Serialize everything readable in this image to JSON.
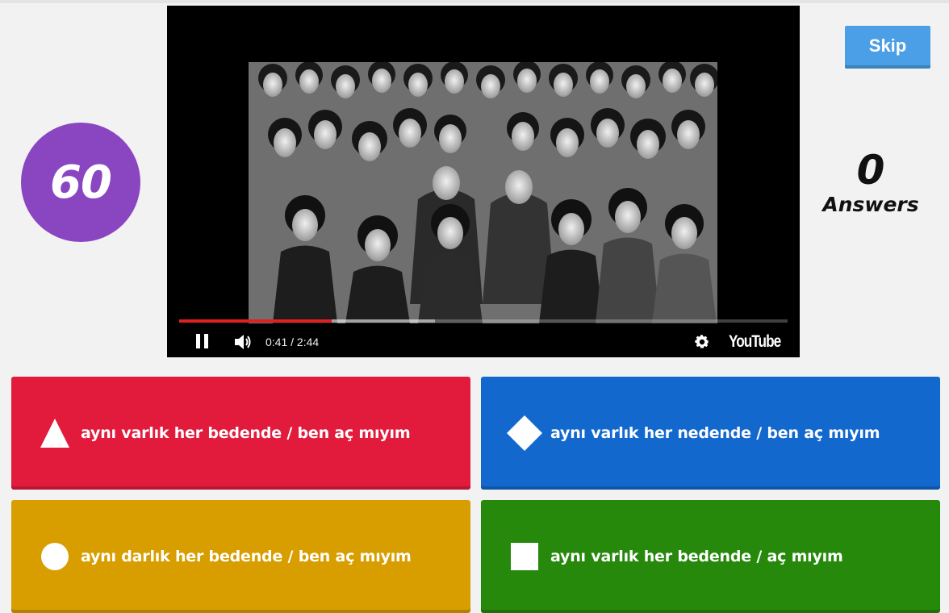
{
  "timer": {
    "value": "60"
  },
  "video": {
    "time_display": "0:41 / 2:44",
    "progress_fraction": 0.25,
    "buffer_fraction": 0.42,
    "brand": "YouTube",
    "progress_color": "#e01f1f"
  },
  "skip": {
    "label": "Skip"
  },
  "answers": {
    "count": "0",
    "label": "Answers"
  },
  "options": [
    {
      "shape": "triangle-icon",
      "color": "#e21b3c",
      "text": "aynı varlık her bedende / ben aç mıyım"
    },
    {
      "shape": "diamond-icon",
      "color": "#1368ce",
      "text": "aynı varlık her nedende / ben aç mıyım"
    },
    {
      "shape": "circle-icon",
      "color": "#d89e00",
      "text": "aynı darlık her bedende / ben aç mıyım"
    },
    {
      "shape": "square-icon",
      "color": "#26890c",
      "text": "aynı varlık her bedende / aç mıyım"
    }
  ],
  "colors": {
    "timer": "#8a46c1",
    "skip": "#4a9fe6",
    "background": "#f2f2f2"
  }
}
